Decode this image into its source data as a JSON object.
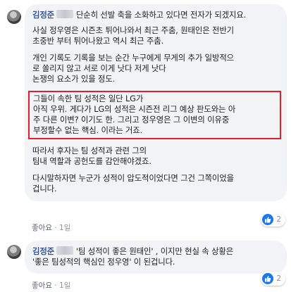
{
  "comment1": {
    "author": "김정준",
    "text_after_name": "단순히 선발 축을 소화하고 있다면 전자가 되겠지요.",
    "paragraphs": [
      "사실 정우영은 시즌초 튀어나와서 최근 주춤, 원태인은 전반기\n초중반 부터 튀어나왔고 역시 최근 주춤.",
      "개인 기록도 기록을 보는 순간 누구에게 무게의 추가 일방적으\n로 쏠리지 않고 서로 이게 낫다 저게 낫다\n논쟁의 요소가 있을 정도."
    ],
    "highlighted": "그들이 속한 팀 성적은 일단 LG가\n아직 우위. 게다가 LG의 성적은 시즌전 리그 예상 판도와는 아\n주 다른 이변? 이기도 한. 그리고 정우영은 그 이변의 이유중\n부정할수 없는 핵심. 이라는 거죠.",
    "paragraphs_after": [
      "따라서 후자는 팀 성적과 관련 그의\n팀내 역할과 공헌도를 감안해야겠죠.",
      "다시말하자면 누군가 성적이 압도적이었다면 그건 그쪽이었을\n겁니다."
    ],
    "like_label": "좋아요",
    "separator": "·",
    "time": "1일",
    "reaction_count": "2",
    "highlight_color": "#e0202e"
  },
  "comment2": {
    "author": "김정준",
    "text_after_name": "'팀 성적이 좋은 원태인' , 이지만 현실 속 상황은\n'좋은 팀성적의 핵심인 정우영' 이 된겁니다.",
    "like_label": "좋아요",
    "separator": "·",
    "time": "1일",
    "reaction_count": "2"
  },
  "colors": {
    "author": "#385898",
    "bubble_bg": "#f2f3f5",
    "like_badge": "#1877f2"
  }
}
